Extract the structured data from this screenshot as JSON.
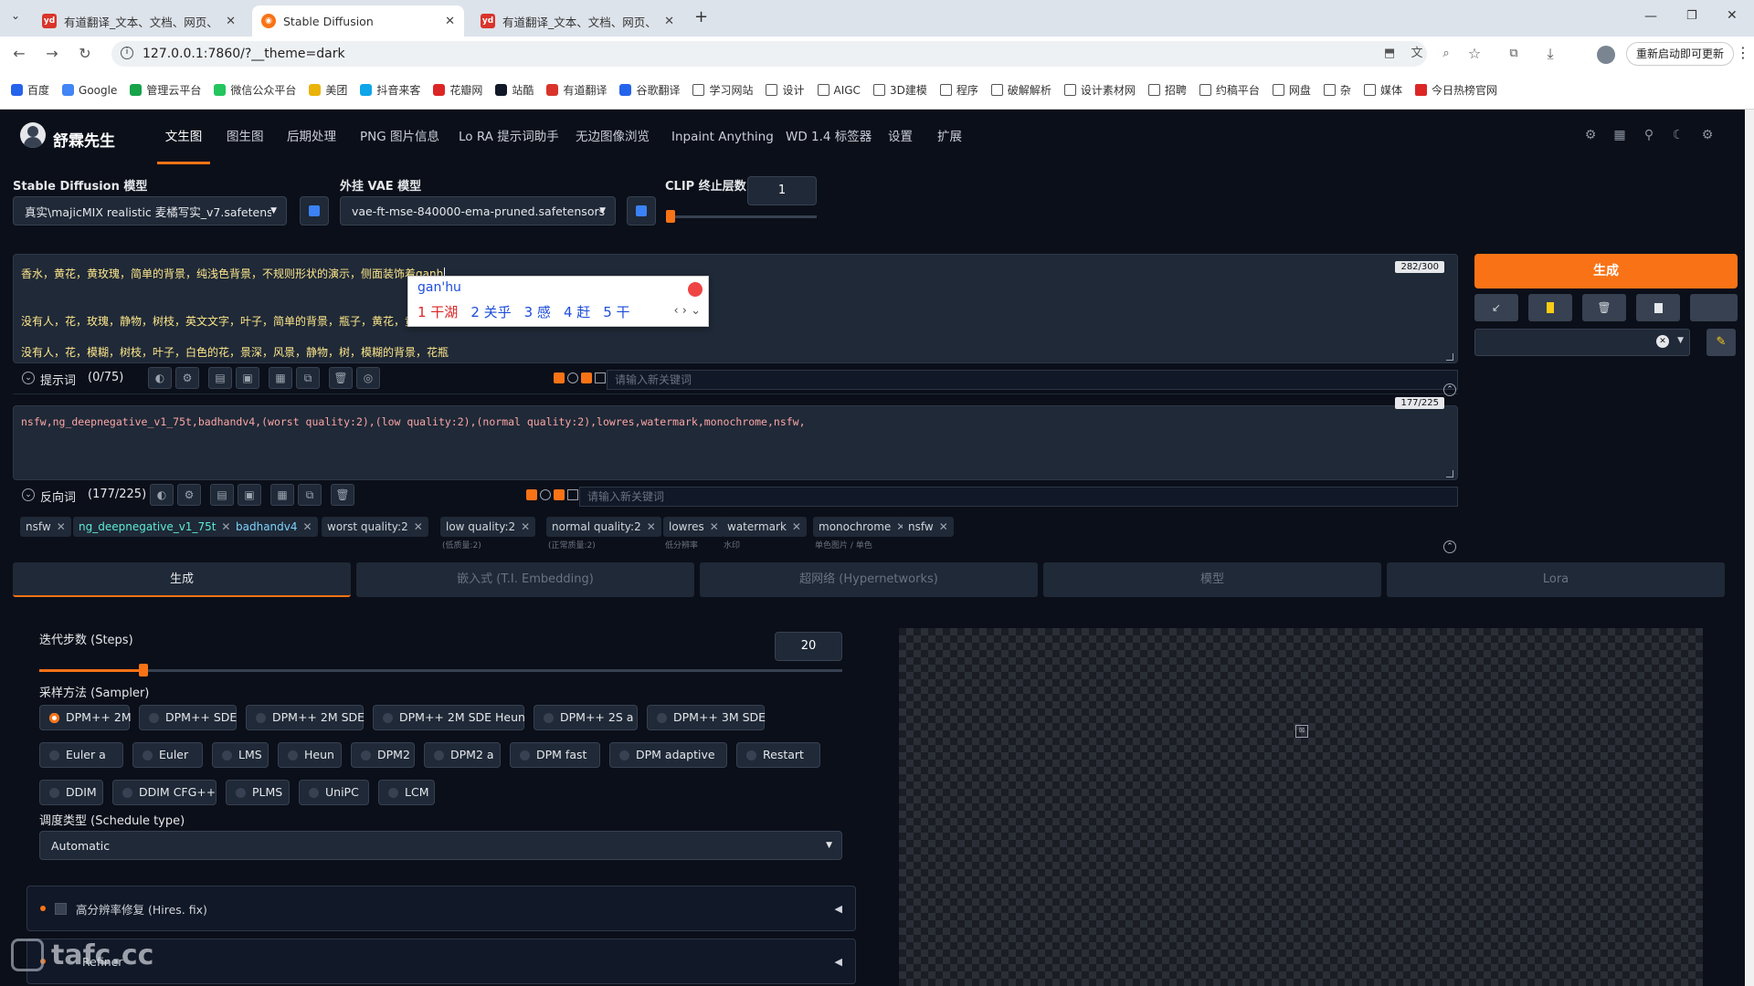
{
  "browser": {
    "tabs": [
      {
        "title": "有道翻译_文本、文档、网页、",
        "active": false
      },
      {
        "title": "Stable Diffusion",
        "active": true
      },
      {
        "title": "有道翻译_文本、文档、网页、",
        "active": false
      }
    ],
    "url": "127.0.0.1:7860/?__theme=dark",
    "restart_label": "重新启动即可更新",
    "bookmarks": [
      "百度",
      "Google",
      "管理云平台",
      "微信公众平台",
      "美团",
      "抖音来客",
      "花瓣网",
      "站酷",
      "有道翻译",
      "谷歌翻译",
      "学习网站",
      "设计",
      "AIGC",
      "3D建模",
      "程序",
      "破解解析",
      "设计素材网",
      "招聘",
      "约稿平台",
      "网盘",
      "杂",
      "媒体",
      "今日热榜官网"
    ]
  },
  "header": {
    "brand": "舒霖先生",
    "tabs": [
      "文生图",
      "图生图",
      "后期处理",
      "PNG 图片信息",
      "Lo RA 提示词助手",
      "无边图像浏览",
      "Inpaint Anything",
      "WD 1.4 标签器",
      "设置",
      "扩展"
    ],
    "active_tab": "文生图"
  },
  "models": {
    "sd_label": "Stable Diffusion 模型",
    "sd_value": "真实\\majicMIX realistic 麦橘写实_v7.safetenso",
    "vae_label": "外挂 VAE 模型",
    "vae_value": "vae-ft-mse-840000-ema-pruned.safetensors",
    "clip_label": "CLIP 终止层数",
    "clip_value": "1"
  },
  "prompt": {
    "counter": "282/300",
    "line1": "香水，黄花，黄玫瑰，简单的背景，纯浅色背景，不规则形状的演示，侧面装饰着ganh",
    "line2": "没有人，花，玫瑰，静物，树枝，英文文字，叶子，简单的背景，瓶子，黄花，黄",
    "line3": "没有人，花，模糊，树枝，叶子，白色的花，景深，风景，静物，树，模糊的背景，花瓶",
    "label": "提示词",
    "count": "(0/75)",
    "kw_placeholder": "请输入新关键词"
  },
  "ime": {
    "input": "gan'hu",
    "candidates": [
      "1 干湖",
      "2 关乎",
      "3 感",
      "4 赶",
      "5 干"
    ]
  },
  "negative": {
    "counter": "177/225",
    "text": "nsfw,ng_deepnegative_v1_75t,badhandv4,(worst quality:2),(low quality:2),(normal quality:2),lowres,watermark,monochrome,nsfw,",
    "label": "反向词",
    "count": "(177/225)",
    "kw_placeholder": "请输入新关键词",
    "chips": [
      {
        "text": "nsfw",
        "sub": ""
      },
      {
        "text": "ng_deepnegative_v1_75t",
        "sub": ""
      },
      {
        "text": "badhandv4",
        "sub": ""
      },
      {
        "text": "worst quality:2",
        "sub": ""
      },
      {
        "text": "low quality:2",
        "sub": "(低质量:2)"
      },
      {
        "text": "normal quality:2",
        "sub": "(正常质量:2)"
      },
      {
        "text": "lowres",
        "sub": "低分辨率"
      },
      {
        "text": "watermark",
        "sub": "水印"
      },
      {
        "text": "monochrome",
        "sub": "单色图片 / 单色"
      },
      {
        "text": "nsfw",
        "sub": ""
      }
    ]
  },
  "generate_label": "生成",
  "subtabs": [
    "生成",
    "嵌入式 (T.I. Embedding)",
    "超网络 (Hypernetworks)",
    "模型",
    "Lora"
  ],
  "steps": {
    "label": "迭代步数 (Steps)",
    "value": "20",
    "fraction": 0.13
  },
  "sampler": {
    "label": "采样方法 (Sampler)",
    "selected": "DPM++ 2M",
    "options": [
      [
        "DPM++ 2M",
        "DPM++ SDE",
        "DPM++ 2M SDE",
        "DPM++ 2M SDE Heun",
        "DPM++ 2S a",
        "DPM++ 3M SDE"
      ],
      [
        "Euler a",
        "Euler",
        "LMS",
        "Heun",
        "DPM2",
        "DPM2 a",
        "DPM fast",
        "DPM adaptive",
        "Restart"
      ],
      [
        "DDIM",
        "DDIM CFG++",
        "PLMS",
        "UniPC",
        "LCM"
      ]
    ]
  },
  "schedule": {
    "label": "调度类型 (Schedule type)",
    "value": "Automatic"
  },
  "hires_label": "高分辨率修复 (Hires. fix)",
  "refiner_label": "Refiner",
  "watermark": "tafc.cc"
}
